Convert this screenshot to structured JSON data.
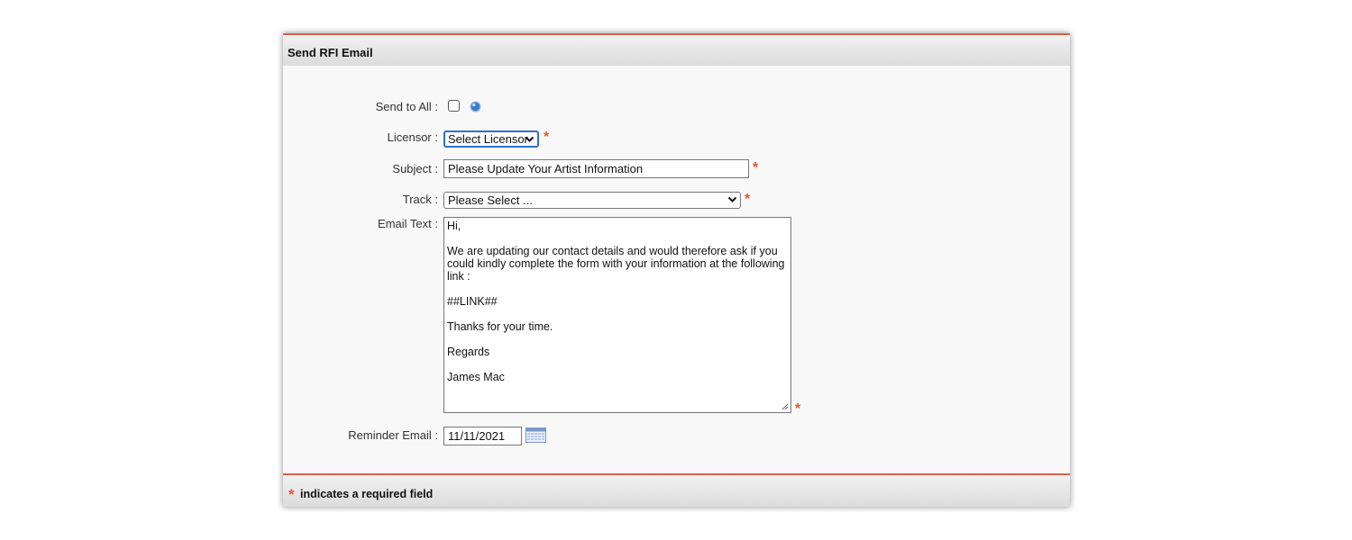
{
  "panel": {
    "title": "Send RFI Email"
  },
  "form": {
    "send_to_all_label": "Send to All :",
    "send_to_all_checked": false,
    "licensor_label": "Licensor :",
    "licensor_value": "Select Licensor",
    "subject_label": "Subject :",
    "subject_value": "Please Update Your Artist Information",
    "track_label": "Track :",
    "track_value": "Please Select ...",
    "email_text_label": "Email Text :",
    "email_text_lines": [
      "Hi,",
      "We are updating our contact details and would therefore ask if you",
      "could kindly complete the form with your information at the following",
      "link :",
      "##LINK##",
      "Thanks for your time.",
      "Regards",
      "James Mac"
    ],
    "reminder_label": "Reminder Email :",
    "reminder_value": "11/11/2021",
    "required_marker": "*"
  },
  "footer": {
    "required_marker": "*",
    "note": "indicates a required field"
  },
  "icons": {
    "help": "help-icon",
    "calendar": "calendar-icon",
    "chevron": "chevron-down-icon",
    "resize": "resize-grip-icon"
  },
  "colors": {
    "accent": "#d9604a",
    "required": "#e8562a",
    "focus": "#2f6fd0"
  }
}
